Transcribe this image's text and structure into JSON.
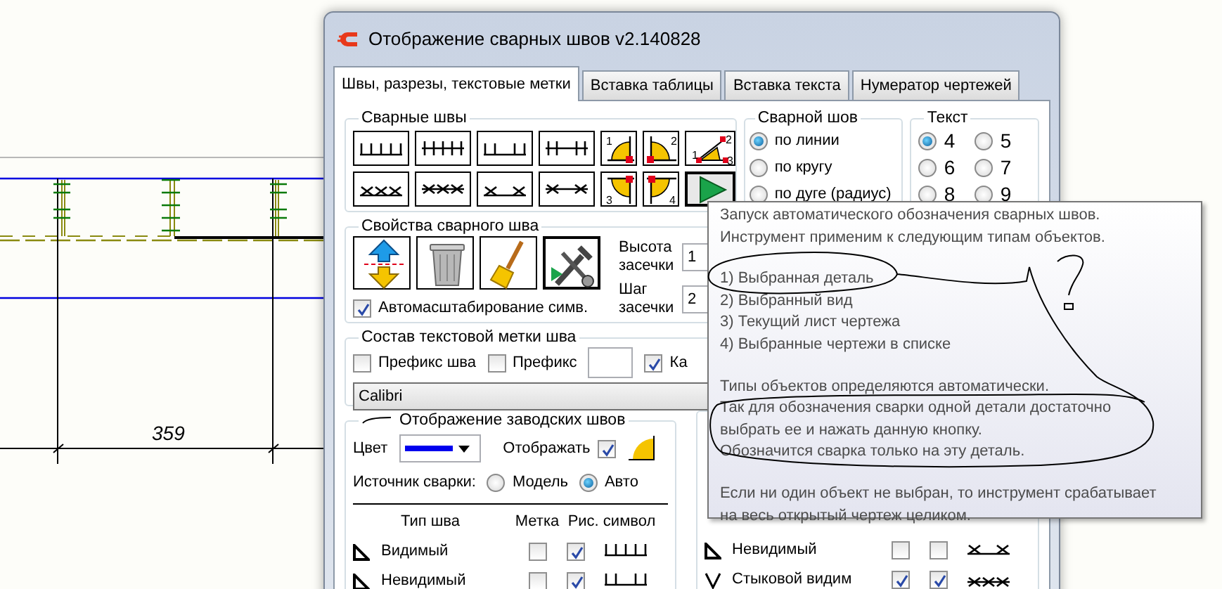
{
  "drawing": {
    "dimension": "359"
  },
  "window": {
    "title": "Отображение сварных швов v2.140828"
  },
  "tabs": [
    {
      "label": "Швы, разрезы, текстовые метки",
      "selected": true
    },
    {
      "label": "Вставка таблицы",
      "selected": false
    },
    {
      "label": "Вставка текста",
      "selected": false
    },
    {
      "label": "Нумератор чертежей",
      "selected": false
    }
  ],
  "weld_seams": {
    "title": "Сварные швы",
    "buttons": [
      {
        "kind": "ticks"
      },
      {
        "kind": "ticks-cross"
      },
      {
        "kind": "ticks-gap"
      },
      {
        "kind": "ticks-cross-gap"
      },
      {
        "kind": "quadrant",
        "labels": [
          "1"
        ]
      },
      {
        "kind": "quadrant",
        "labels": [
          "2"
        ]
      },
      {
        "kind": "angle",
        "labels": [
          "1",
          "2",
          "3"
        ]
      },
      {
        "kind": "x"
      },
      {
        "kind": "x-cross"
      },
      {
        "kind": "x-gap"
      },
      {
        "kind": "x-cross-gap"
      },
      {
        "kind": "quadrant",
        "labels": [
          "3"
        ]
      },
      {
        "kind": "quadrant",
        "labels": [
          "4"
        ]
      },
      {
        "kind": "play"
      }
    ]
  },
  "seam_shape": {
    "title": "Сварной шов",
    "options": [
      {
        "label": "по линии",
        "selected": true
      },
      {
        "label": "по кругу",
        "selected": false
      },
      {
        "label": "по дуге (радиус)",
        "selected": false
      }
    ]
  },
  "text_size": {
    "title": "Текст",
    "options": [
      {
        "label": "4",
        "selected": true
      },
      {
        "label": "5",
        "selected": false
      },
      {
        "label": "6",
        "selected": false
      },
      {
        "label": "7",
        "selected": false
      },
      {
        "label": "8",
        "selected": false
      },
      {
        "label": "9",
        "selected": false
      }
    ]
  },
  "seam_properties": {
    "title": "Свойства сварного шва",
    "tools": [
      {
        "kind": "flip"
      },
      {
        "kind": "delete"
      },
      {
        "kind": "clean"
      },
      {
        "kind": "run"
      }
    ],
    "fields": [
      {
        "label": "Высота засечки",
        "value": "1"
      },
      {
        "label": "Шаг засечки",
        "value": "2"
      }
    ],
    "autoscale": {
      "label": "Автомасштабирование симв.",
      "checked": true
    }
  },
  "label_composition": {
    "title": "Состав текстовой метки шва",
    "options": [
      {
        "label": "Префикс шва",
        "checked": false
      },
      {
        "label": "Префикс",
        "checked": false
      },
      {
        "label": "Ка",
        "checked": true
      }
    ],
    "font": "Calibri"
  },
  "factory_seams": {
    "title": "Отображение заводских швов",
    "color_label": "Цвет",
    "show": {
      "label": "Отображать",
      "checked": true
    },
    "source_label": "Источник сварки:",
    "sources": [
      {
        "label": "Модель",
        "selected": false
      },
      {
        "label": "Авто",
        "selected": true
      }
    ],
    "columns": [
      "Тип шва",
      "Метка",
      "Рис. символ"
    ],
    "rows": [
      {
        "kind": "fillet",
        "name": "Видимый",
        "mark": false,
        "symbol": true
      },
      {
        "kind": "fillet",
        "name": "Невидимый",
        "mark": false,
        "symbol": true
      }
    ]
  },
  "butt_seams": {
    "rows": [
      {
        "kind": "fillet",
        "name": "Невидимый",
        "mark": false,
        "symbol": false
      },
      {
        "kind": "butt",
        "name": "Стыковой видим",
        "mark": true,
        "symbol": true
      }
    ]
  },
  "tooltip": {
    "intro": [
      "Запуск автоматического обозначения сварных швов.",
      "Инструмент применим к следующим типам объектов."
    ],
    "items": [
      "1) Выбранная деталь",
      "2) Выбранный вид",
      "3) Текущий лист чертежа",
      "4) Выбранные чертежи в списке"
    ],
    "notes": [
      [
        "Типы объектов определяются автоматически.",
        "Так для обозначения сварки одной детали достаточно",
        "выбрать ее и нажать данную кнопку.",
        "Обозначится сварка только на эту деталь."
      ],
      [
        "Если ни один объект не выбран, то инструмент срабатывает",
        "на весь открытый чертеж целиком."
      ]
    ]
  }
}
